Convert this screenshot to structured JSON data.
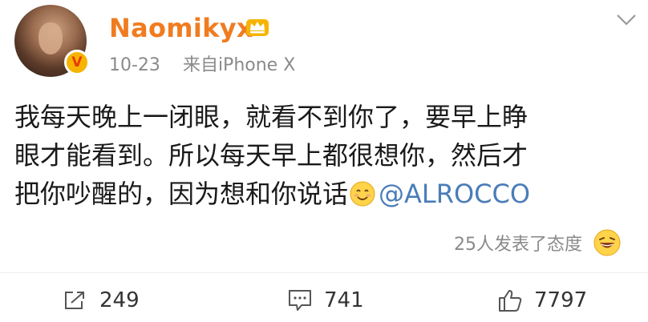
{
  "post": {
    "username": "Naomikyx",
    "verified_badge": "V",
    "time": "10-23",
    "source": "来自iPhone X",
    "content_lines": [
      "我每天晚上一闭眼，就看不到你了，要早上睁",
      "眼才能看到。所以每天早上都很想你，然后才",
      "把你吵醒的，因为想和你说话"
    ],
    "mention": "@ALROCCO",
    "reactions": "25人发表了态度"
  },
  "actions": {
    "repost": "249",
    "comment": "741",
    "like": "7797"
  },
  "icons": {
    "crown": "crown-icon",
    "more": "chevron-down-icon",
    "smile": "smile-emoji-icon",
    "grin": "grin-emoji-icon",
    "repost": "repost-icon",
    "comment": "comment-icon",
    "like": "thumbs-up-icon"
  },
  "colors": {
    "username": "#f07c20",
    "mention": "#4a7db8",
    "meta": "#8a8a8a",
    "badge": "#f6b400"
  }
}
